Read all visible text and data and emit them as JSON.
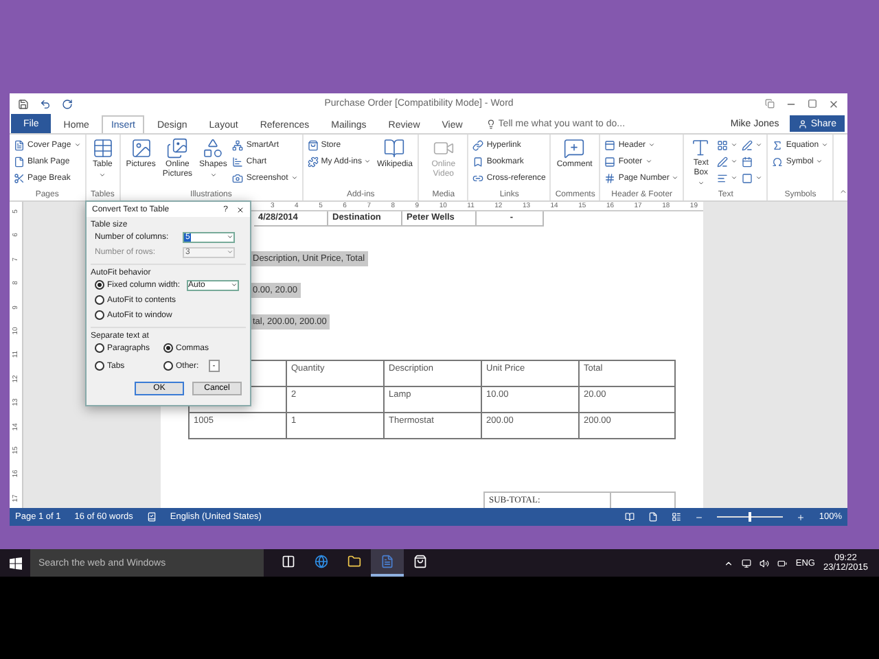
{
  "window": {
    "title": "Purchase Order [Compatibility Mode] - Word"
  },
  "ribbon_tabs": [
    {
      "label": "File",
      "kind": "file",
      "selected": false
    },
    {
      "label": "Home",
      "kind": "tab",
      "selected": false
    },
    {
      "label": "Insert",
      "kind": "tab",
      "selected": true
    },
    {
      "label": "Design",
      "kind": "tab",
      "selected": false
    },
    {
      "label": "Layout",
      "kind": "tab",
      "selected": false
    },
    {
      "label": "References",
      "kind": "tab",
      "selected": false
    },
    {
      "label": "Mailings",
      "kind": "tab",
      "selected": false
    },
    {
      "label": "Review",
      "kind": "tab",
      "selected": false
    },
    {
      "label": "View",
      "kind": "tab",
      "selected": false
    }
  ],
  "tell_me": {
    "placeholder": "Tell me what you want to do..."
  },
  "user": "Mike Jones",
  "share_button": "Share",
  "ribbon_groups": [
    {
      "label": "Pages",
      "items": [
        {
          "kind": "small",
          "label": "Cover Page",
          "has_menu": true
        },
        {
          "kind": "small",
          "label": "Blank Page",
          "has_menu": false
        },
        {
          "kind": "small",
          "label": "Page Break",
          "has_menu": false
        }
      ]
    },
    {
      "label": "Tables",
      "items": [
        {
          "kind": "large",
          "label": "Table",
          "has_menu": true
        }
      ]
    },
    {
      "label": "Illustrations",
      "items": [
        {
          "kind": "large",
          "label": "Pictures",
          "has_menu": false
        },
        {
          "kind": "large",
          "label": "Online Pictures",
          "has_menu": false
        },
        {
          "kind": "large",
          "label": "Shapes",
          "has_menu": true
        },
        {
          "kind": "small",
          "label": "SmartArt",
          "has_menu": false
        },
        {
          "kind": "small",
          "label": "Chart",
          "has_menu": false
        },
        {
          "kind": "small",
          "label": "Screenshot",
          "has_menu": true
        }
      ]
    },
    {
      "label": "Add-ins",
      "items": [
        {
          "kind": "small",
          "label": "Store",
          "has_menu": false
        },
        {
          "kind": "small",
          "label": "My Add-ins",
          "has_menu": true
        },
        {
          "kind": "large",
          "label": "Wikipedia",
          "has_menu": false
        }
      ]
    },
    {
      "label": "Media",
      "items": [
        {
          "kind": "large",
          "label": "Online Video",
          "has_menu": false,
          "disabled": true
        }
      ]
    },
    {
      "label": "Links",
      "items": [
        {
          "kind": "small",
          "label": "Hyperlink",
          "has_menu": false
        },
        {
          "kind": "small",
          "label": "Bookmark",
          "has_menu": false
        },
        {
          "kind": "small",
          "label": "Cross-reference",
          "has_menu": false
        }
      ]
    },
    {
      "label": "Comments",
      "items": [
        {
          "kind": "large",
          "label": "Comment",
          "has_menu": false
        }
      ]
    },
    {
      "label": "Header & Footer",
      "items": [
        {
          "kind": "small",
          "label": "Header",
          "has_menu": true
        },
        {
          "kind": "small",
          "label": "Footer",
          "has_menu": true
        },
        {
          "kind": "small",
          "label": "Page Number",
          "has_menu": true
        }
      ]
    },
    {
      "label": "Text",
      "items": [
        {
          "kind": "large",
          "label": "Text Box",
          "has_menu": true
        },
        {
          "kind": "icon",
          "has_menu": true
        },
        {
          "kind": "icon",
          "has_menu": true
        },
        {
          "kind": "icon",
          "has_menu": true
        },
        {
          "kind": "icon",
          "has_menu": true
        },
        {
          "kind": "icon",
          "has_menu": false
        },
        {
          "kind": "icon",
          "has_menu": true
        }
      ]
    },
    {
      "label": "Symbols",
      "items": [
        {
          "kind": "small",
          "label": "Equation",
          "has_menu": true
        },
        {
          "kind": "small",
          "label": "Symbol",
          "has_menu": true
        }
      ]
    }
  ],
  "ruler": {
    "horizontal": [
      "3",
      "4",
      "5",
      "6",
      "7",
      "8",
      "9",
      "10",
      "11",
      "12",
      "13",
      "14",
      "15",
      "16",
      "17",
      "18",
      "19"
    ],
    "vertical": [
      "5",
      "6",
      "7",
      "8",
      "9",
      "10",
      "11",
      "12",
      "13",
      "14",
      "15",
      "16",
      "17"
    ]
  },
  "document": {
    "header_row": [
      "4/28/2014",
      "Destination",
      "Peter Wells",
      "-"
    ],
    "selected_lines": [
      "Description, Unit Price, Total",
      "0.00, 20.00",
      "tal, 200.00, 200.00"
    ],
    "table": [
      [
        "Quantity",
        "Description",
        "Unit Price",
        "Total"
      ],
      [
        "2",
        "Lamp",
        "10.00",
        "20.00"
      ],
      [
        "1005",
        "1",
        "Thermostat",
        "200.00",
        "200.00"
      ]
    ],
    "subtotal_label": "SUB-TOTAL:"
  },
  "dialog": {
    "title": "Convert Text to Table",
    "help": "?",
    "table_size_label": "Table size",
    "columns": {
      "label": "Number of columns:",
      "value": "5",
      "disabled": false
    },
    "rows": {
      "label": "Number of rows:",
      "value": "3",
      "disabled": true
    },
    "autofit_label": "AutoFit behavior",
    "autofit_options": [
      {
        "label": "Fixed column width:",
        "selected": true,
        "value": "Auto"
      },
      {
        "label": "AutoFit to contents",
        "selected": false
      },
      {
        "label": "AutoFit to window",
        "selected": false
      }
    ],
    "separate_label": "Separate text at",
    "separators": [
      {
        "label": "Paragraphs",
        "selected": false
      },
      {
        "label": "Commas",
        "selected": true
      },
      {
        "label": "Tabs",
        "selected": false
      },
      {
        "label": "Other:",
        "selected": false,
        "kind": "other"
      }
    ],
    "other_separator_text": "-",
    "ok": "OK",
    "cancel": "Cancel"
  },
  "status_bar": {
    "page": "Page 1 of 1",
    "words": "16 of 60 words",
    "language": "English (United States)",
    "zoom": {
      "level": 0.5,
      "reading": "100%"
    }
  },
  "taskbar": {
    "search": {
      "placeholder": "Search the web and Windows"
    },
    "apps": [
      {
        "selected": false
      },
      {
        "selected": false
      },
      {
        "selected": false
      },
      {
        "selected": true
      },
      {
        "selected": false
      }
    ],
    "language": "ENG",
    "time": "09:22",
    "date": "23/12/2015"
  }
}
